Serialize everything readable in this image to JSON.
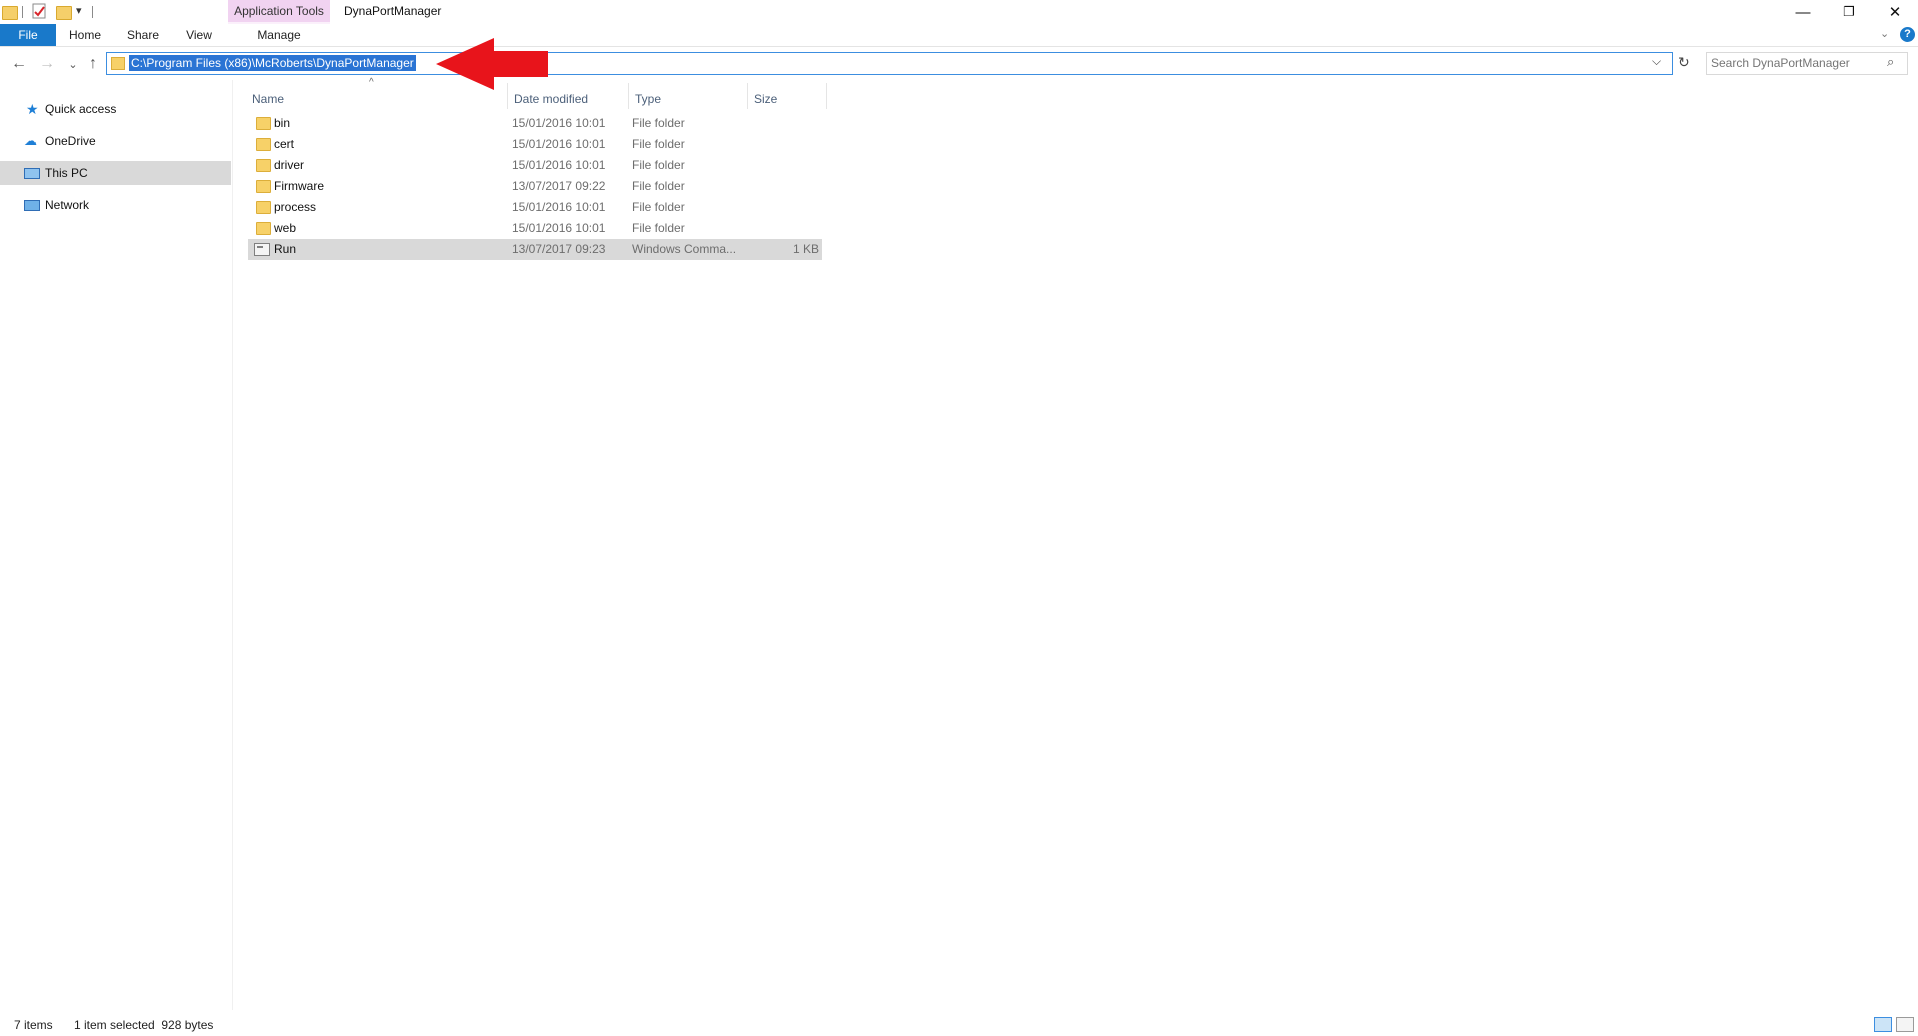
{
  "window": {
    "title": "DynaPortManager",
    "context_group": "Application Tools",
    "controls": {
      "minimize": "—",
      "restore": "❐",
      "close": "✕"
    }
  },
  "ribbon": {
    "tabs": [
      "File",
      "Home",
      "Share",
      "View",
      "Manage"
    ]
  },
  "address": {
    "path": "C:\\Program Files (x86)\\McRoberts\\DynaPortManager"
  },
  "search": {
    "placeholder": "Search DynaPortManager"
  },
  "navpane": {
    "items": [
      {
        "label": "Quick access",
        "icon": "star-icon"
      },
      {
        "label": "OneDrive",
        "icon": "cloud-icon"
      },
      {
        "label": "This PC",
        "icon": "computer-icon",
        "selected": true
      },
      {
        "label": "Network",
        "icon": "network-icon"
      }
    ]
  },
  "columns": [
    "Name",
    "Date modified",
    "Type",
    "Size"
  ],
  "files": [
    {
      "name": "bin",
      "date": "15/01/2016 10:01",
      "type": "File folder",
      "size": ""
    },
    {
      "name": "cert",
      "date": "15/01/2016 10:01",
      "type": "File folder",
      "size": ""
    },
    {
      "name": "driver",
      "date": "15/01/2016 10:01",
      "type": "File folder",
      "size": ""
    },
    {
      "name": "Firmware",
      "date": "13/07/2017 09:22",
      "type": "File folder",
      "size": ""
    },
    {
      "name": "process",
      "date": "15/01/2016 10:01",
      "type": "File folder",
      "size": ""
    },
    {
      "name": "web",
      "date": "15/01/2016 10:01",
      "type": "File folder",
      "size": ""
    },
    {
      "name": "Run",
      "date": "13/07/2017 09:23",
      "type": "Windows Comma...",
      "size": "1 KB",
      "selected": true
    }
  ],
  "status": {
    "count": "7 items",
    "selection": "1 item selected  928 bytes"
  },
  "colors": {
    "accent": "#1979ca",
    "annotation_arrow": "#e8141b",
    "address_highlight": "#2a74d4"
  }
}
